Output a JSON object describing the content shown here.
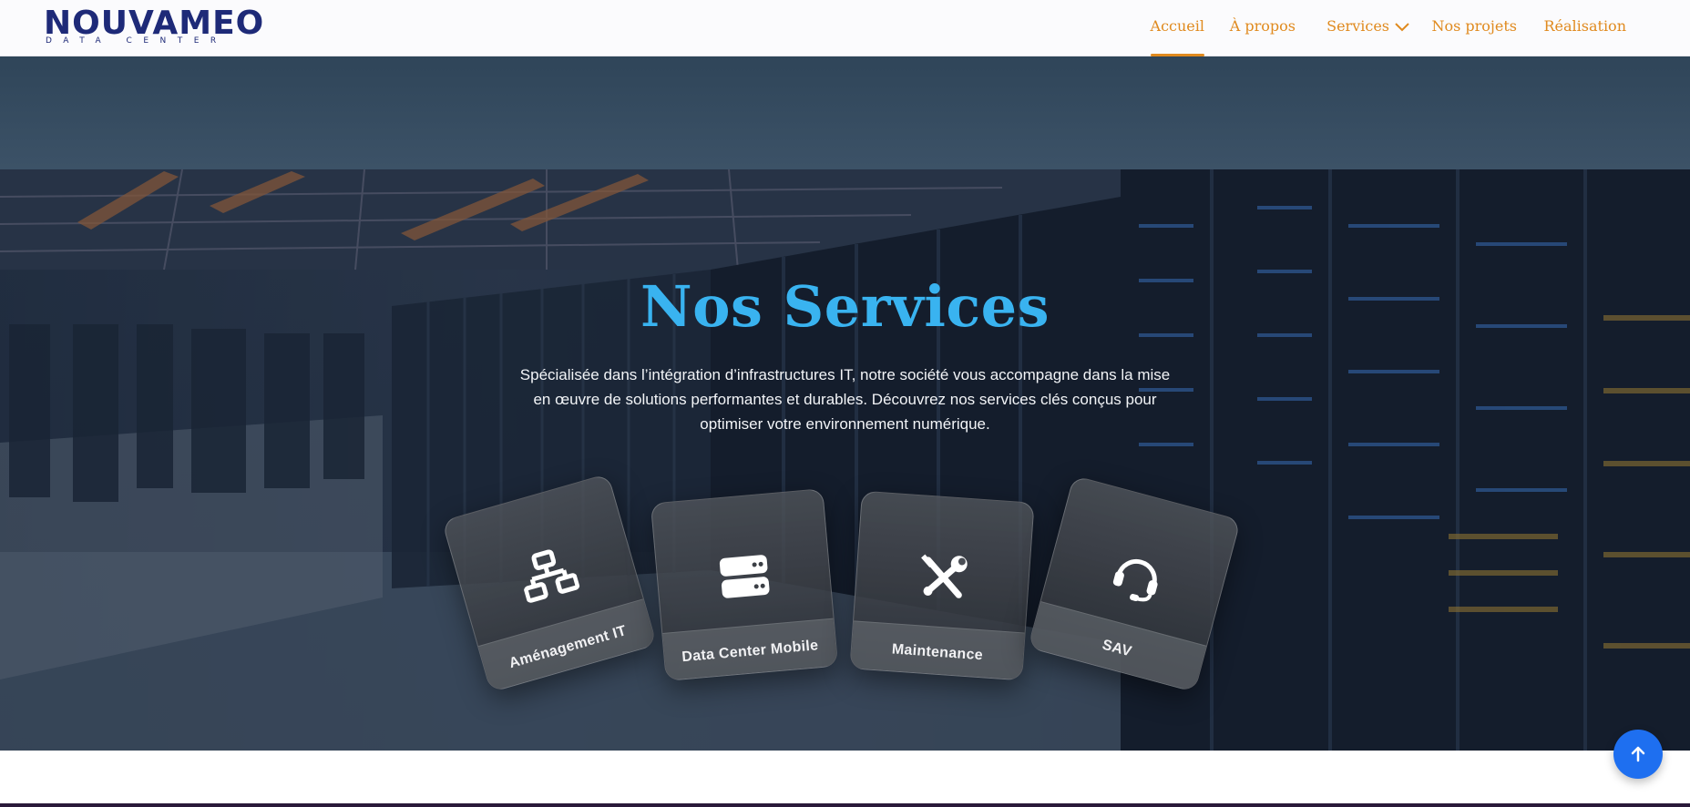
{
  "brand": {
    "logo_word": "NOUVAMEO",
    "logo_sub": "DATA CENTER",
    "primary_color": "#1e2a78",
    "accent_color": "#e08a1e"
  },
  "nav": {
    "items": [
      {
        "label": "Accueil",
        "active": true
      },
      {
        "label": "À propos",
        "active": false
      },
      {
        "label": "Services",
        "active": false,
        "has_dropdown": true
      },
      {
        "label": "Nos projets",
        "active": false
      },
      {
        "label": "Réalisation",
        "active": false
      }
    ]
  },
  "hero": {
    "title": "Nos Services",
    "title_color": "#39b3f0",
    "description": "Spécialisée dans l’intégration d’infrastructures IT, notre société vous accompagne dans la mise en œuvre de solutions performantes et durables. Découvrez nos services clés conçus pour optimiser votre environnement numérique."
  },
  "services": [
    {
      "label": "Aménagement IT",
      "icon": "network-icon"
    },
    {
      "label": "Data Center Mobile",
      "icon": "server-icon"
    },
    {
      "label": "Maintenance",
      "icon": "tools-icon"
    },
    {
      "label": "SAV",
      "icon": "headset-icon"
    }
  ],
  "back_to_top": {
    "icon": "arrow-up-icon",
    "color": "#1e6ff0"
  }
}
